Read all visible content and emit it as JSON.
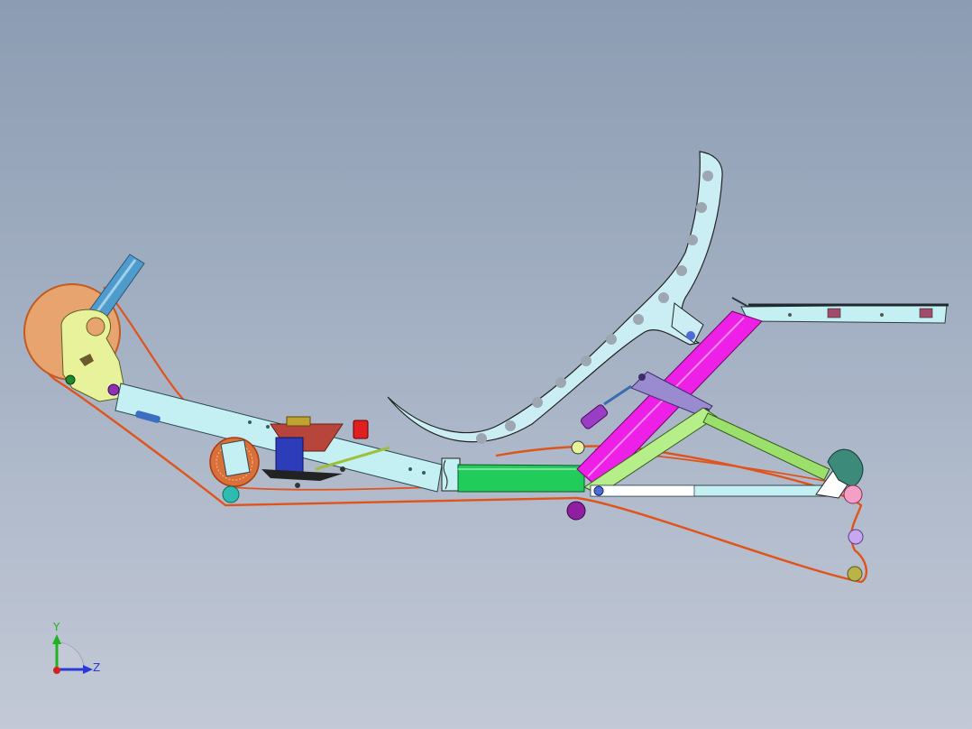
{
  "viewport": {
    "background_top": "#8c9cb2",
    "background_bottom": "#c3c9d6"
  },
  "triad": {
    "y_label": "Y",
    "z_label": "Z",
    "y_color": "#1fb31f",
    "z_color": "#2b3ad6",
    "x_color": "#d62020"
  },
  "model": {
    "chain_color": "#e0541c",
    "seat_color": "#d8f1f6",
    "frame_color": "#cbeef5",
    "boom_color": "#c4eff3",
    "pink_member_color": "#ee1fe6",
    "green_member_color": "#22cc5a",
    "rear_arm_color": "#b6ef8a",
    "chainring_color": "#e8a46e",
    "seatpost_color": "#4f9bcc",
    "bracket_color": "#e8f29a"
  }
}
